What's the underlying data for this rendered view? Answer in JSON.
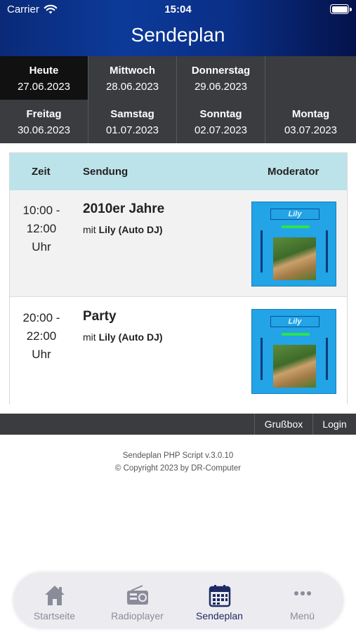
{
  "status": {
    "carrier": "Carrier",
    "time": "15:04"
  },
  "header": {
    "title": "Sendeplan"
  },
  "days": [
    {
      "name": "Heute",
      "date": "27.06.2023"
    },
    {
      "name": "Mittwoch",
      "date": "28.06.2023"
    },
    {
      "name": "Donnerstag",
      "date": "29.06.2023"
    },
    {
      "name": "Freitag",
      "date": "30.06.2023"
    },
    {
      "name": "Samstag",
      "date": "01.07.2023"
    },
    {
      "name": "Sonntag",
      "date": "02.07.2023"
    },
    {
      "name": "Montag",
      "date": "03.07.2023"
    }
  ],
  "table": {
    "headers": {
      "time": "Zeit",
      "show": "Sendung",
      "moderator": "Moderator"
    },
    "rows": [
      {
        "time_start": "10:00 -",
        "time_end": "12:00",
        "time_unit": "Uhr",
        "show": "2010er Jahre",
        "host_prefix": "mit",
        "host": "Lily (Auto DJ)",
        "thumb_text": "Lily"
      },
      {
        "time_start": "20:00 -",
        "time_end": "22:00",
        "time_unit": "Uhr",
        "show": "Party",
        "host_prefix": "mit",
        "host": "Lily (Auto DJ)",
        "thumb_text": "Lily"
      }
    ]
  },
  "footer_links": {
    "guestbook": "Grußbox",
    "login": "Login"
  },
  "credits": {
    "line1": "Sendeplan PHP Script v.3.0.10",
    "line2": "© Copyright 2023 by DR-Computer"
  },
  "tabs": [
    {
      "label": "Startseite",
      "icon": "home-icon"
    },
    {
      "label": "Radioplayer",
      "icon": "radio-icon"
    },
    {
      "label": "Sendeplan",
      "icon": "calendar-icon"
    },
    {
      "label": "Menü",
      "icon": "more-icon"
    }
  ],
  "colors": {
    "header_start": "#0a2a78",
    "header_end": "#04124a",
    "table_header": "#bde3ea",
    "tab_active": "#1d2a63",
    "tab_inactive": "#8a8c99",
    "thumb_bg": "#22a4e6"
  }
}
